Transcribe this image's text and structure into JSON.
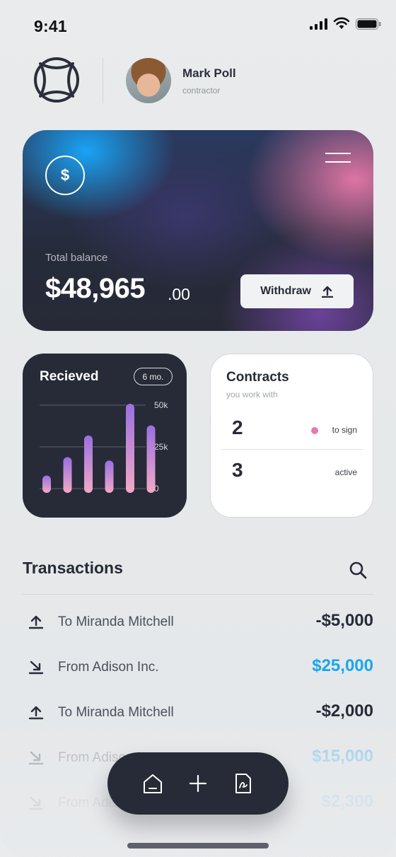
{
  "status_bar": {
    "time": "9:41"
  },
  "header": {
    "logo_icon": "sparkle-circle-logo",
    "user": {
      "name": "Mark Poll",
      "role": "contractor"
    }
  },
  "balance_card": {
    "dollar_icon": "$",
    "label": "Total balance",
    "amount": "$48,965",
    "cents": ".00",
    "withdraw_label": "Withdraw",
    "colors": {
      "blue": "#18aaff",
      "pink": "#e878a8",
      "dark": "#272b37"
    }
  },
  "received_card": {
    "title": "Recieved",
    "period": "6 mo.",
    "chart_data": {
      "type": "bar",
      "title": "Recieved",
      "y_tick_labels": [
        "50k",
        "25k",
        "0"
      ],
      "ylim": [
        0,
        50000
      ],
      "values": [
        7000,
        18000,
        31000,
        16000,
        50000,
        37000
      ],
      "grid": true,
      "gradient": [
        "#9b6fe0",
        "#f2a9c6"
      ]
    }
  },
  "contracts_card": {
    "title": "Contracts",
    "subtitle": "you work with",
    "rows": [
      {
        "count": "2",
        "label": "to sign",
        "dot_color": "#e27ab4"
      },
      {
        "count": "3",
        "label": "active"
      }
    ]
  },
  "transactions": {
    "title": "Transactions",
    "search_icon": "search-icon",
    "items": [
      {
        "direction": "out",
        "name": "To Miranda Mitchell",
        "amount": "-$5,000"
      },
      {
        "direction": "in",
        "name": "From Adison Inc.",
        "amount": "$25,000"
      },
      {
        "direction": "out",
        "name": "To Miranda Mitchell",
        "amount": "-$2,000"
      },
      {
        "direction": "in",
        "name": "From Adison Inc.",
        "amount": "$15,000"
      },
      {
        "direction": "in",
        "name": "From Adison Inc.",
        "amount": "$2,300"
      }
    ]
  },
  "bottom_nav": {
    "items": [
      "home-icon",
      "plus-icon",
      "contract-icon"
    ]
  }
}
